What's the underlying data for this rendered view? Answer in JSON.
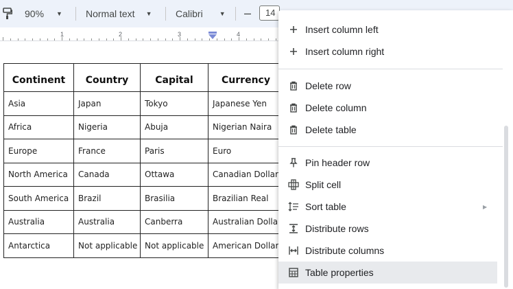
{
  "toolbar": {
    "paint_format_icon": "paint-format-icon",
    "zoom": "90%",
    "style": "Normal text",
    "font": "Calibri",
    "decrease_font_label": "–",
    "font_size": "14"
  },
  "ruler": {
    "numbers": [
      "1",
      "2",
      "3",
      "4"
    ]
  },
  "table": {
    "headers": [
      "Continent",
      "Country",
      "Capital",
      "Currency"
    ],
    "rows": [
      [
        "Asia",
        "Japan",
        "Tokyo",
        "Japanese Yen"
      ],
      [
        "Africa",
        "Nigeria",
        "Abuja",
        "Nigerian Naira"
      ],
      [
        "Europe",
        "France",
        "Paris",
        "Euro"
      ],
      [
        "North America",
        "Canada",
        "Ottawa",
        "Canadian Dollar"
      ],
      [
        "South America",
        "Brazil",
        "Brasilia",
        "Brazilian Real"
      ],
      [
        "Australia",
        "Australia",
        "Canberra",
        "Australian Dollar"
      ],
      [
        "Antarctica",
        "Not applicable",
        "Not applicable",
        "American Dollar"
      ]
    ]
  },
  "menu": {
    "items": [
      {
        "label": "Insert column left",
        "icon": "plus-icon"
      },
      {
        "label": "Insert column right",
        "icon": "plus-icon"
      },
      {
        "label": "Delete row",
        "icon": "trash-icon"
      },
      {
        "label": "Delete column",
        "icon": "trash-icon"
      },
      {
        "label": "Delete table",
        "icon": "trash-icon"
      },
      {
        "label": "Pin header row",
        "icon": "pin-icon"
      },
      {
        "label": "Split cell",
        "icon": "split-cell-icon"
      },
      {
        "label": "Sort table",
        "icon": "sort-icon",
        "submenu": true
      },
      {
        "label": "Distribute rows",
        "icon": "distribute-rows-icon"
      },
      {
        "label": "Distribute columns",
        "icon": "distribute-columns-icon"
      },
      {
        "label": "Table properties",
        "icon": "table-icon",
        "highlighted": true
      }
    ]
  },
  "colors": {
    "toolbar_bg": "#edf2fa",
    "menu_highlight": "#e8eaed",
    "indent_marker": "#7b8bd6"
  }
}
